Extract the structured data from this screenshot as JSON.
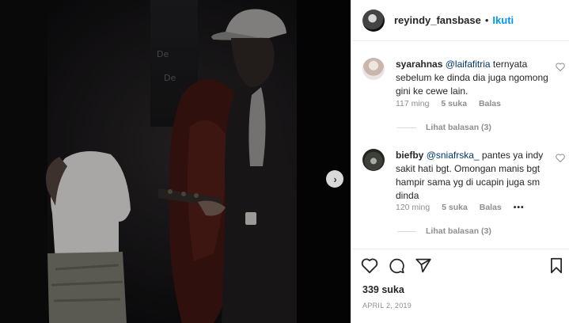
{
  "post": {
    "username": "reyindy_fansbase",
    "separator": "•",
    "follow_label": "Ikuti"
  },
  "comments": [
    {
      "username": "syarahnas",
      "mention": "@laifafitria",
      "text": " ternyata sebelum ke dinda dia juga ngomong gini ke cewe lain.",
      "time": "117 ming",
      "likes": "5 suka",
      "reply_label": "Balas",
      "view_replies": "Lihat balasan (3)"
    },
    {
      "username": "biefby",
      "mention": "@sniafrska_",
      "text": " pantes ya indy sakit hati bgt. Omongan manis bgt hampir sama yg di ucapin juga sm dinda",
      "time": "120 ming",
      "likes": "5 suka",
      "reply_label": "Balas",
      "more": "•••",
      "view_replies": "Lihat balasan (3)"
    }
  ],
  "footer": {
    "likes": "339 suka",
    "date": "APRIL 2, 2019"
  },
  "media": {
    "next_glyph": "›"
  },
  "icons": {
    "like": "heart-icon",
    "comment": "comment-icon",
    "share": "share-icon",
    "save": "bookmark-icon"
  }
}
